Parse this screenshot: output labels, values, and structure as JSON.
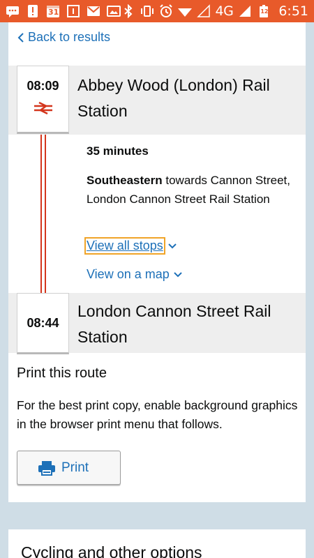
{
  "status_bar": {
    "network": "4G",
    "time": "6:51",
    "calendar_day": "31",
    "battery_level": "12"
  },
  "back_link": {
    "label": "Back to results"
  },
  "journey": {
    "origin": {
      "time": "08:09",
      "name": "Abbey Wood (London) Rail Station"
    },
    "leg": {
      "duration": "35 minutes",
      "operator": "Southeastern",
      "direction": "towards Cannon Street, London Cannon Street Rail Station",
      "view_stops_label": "View all stops",
      "view_map_label": "View on a map"
    },
    "destination": {
      "time": "08:44",
      "name": "London Cannon Street Rail Station"
    }
  },
  "print": {
    "title": "Print this route",
    "description": "For the best print copy, enable background graphics in the browser print menu that follows.",
    "button_label": "Print"
  },
  "next_section": {
    "title": "Cycling and other options"
  },
  "colors": {
    "status_bar": "#e85a2a",
    "link": "#1d70b8",
    "rail_red": "#d4351c",
    "page_bg": "#cfdde6",
    "focus": "#f0a428"
  }
}
